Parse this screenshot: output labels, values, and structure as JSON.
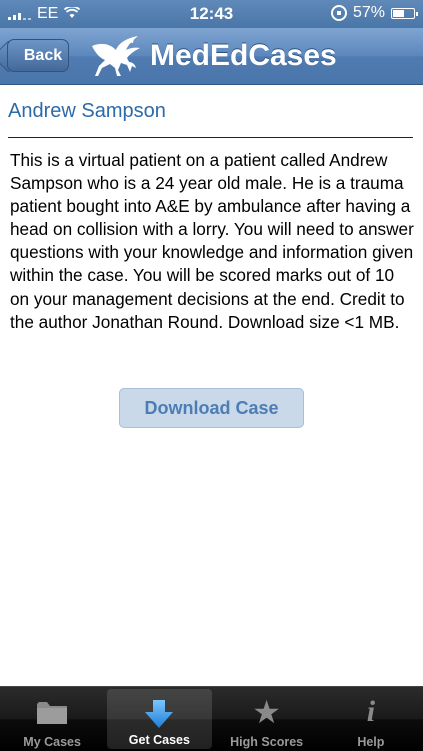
{
  "status_bar": {
    "carrier": "EE",
    "time": "12:43",
    "battery": "57%",
    "battery_level": 0.57
  },
  "nav_bar": {
    "back_label": "Back",
    "app_title": "MedEdCases"
  },
  "case": {
    "title": "Andrew Sampson",
    "description": "This is a virtual patient on a patient called Andrew Sampson who is a 24 year old male. He is a trauma patient bought into A&E by ambulance after having a head on collision with a lorry.  You will need to answer questions with your knowledge and information given within the case. You will be scored marks out of 10 on your management decisions at the end. Credit to the author Jonathan Round. Download size <1 MB.",
    "download_label": "Download Case"
  },
  "tab_bar": {
    "tabs": [
      {
        "label": "My Cases",
        "icon": "folder-icon",
        "active": false
      },
      {
        "label": "Get Cases",
        "icon": "download-arrow-icon",
        "active": true
      },
      {
        "label": "High Scores",
        "icon": "star-icon",
        "active": false
      },
      {
        "label": "Help",
        "icon": "info-icon",
        "active": false
      }
    ]
  },
  "colors": {
    "nav_blue": "#5d88bd",
    "title_blue": "#2d6aa8",
    "button_bg": "#c9d9ea",
    "tab_active_icon": "#3d9be9"
  }
}
